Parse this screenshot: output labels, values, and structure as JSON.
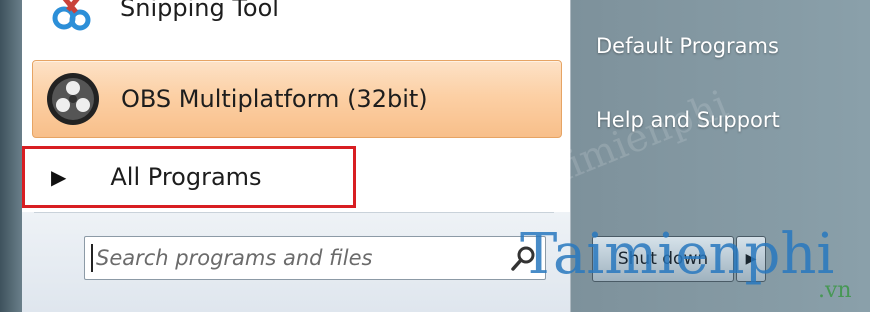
{
  "start_menu": {
    "programs": [
      {
        "label": "Snipping Tool",
        "icon": "scissors-icon"
      },
      {
        "label": "OBS Multiplatform (32bit)",
        "icon": "obs-logo-icon"
      }
    ],
    "all_programs_label": "All Programs",
    "search": {
      "placeholder": "Search programs and files"
    },
    "right_links": [
      "Default Programs",
      "Help and Support"
    ],
    "shutdown_label": "Shut down"
  },
  "watermark": {
    "main": "Taimienphi",
    "sub": ".vn"
  },
  "colors": {
    "highlight": "#fcd0a5",
    "annotation_box": "#d81e22"
  }
}
